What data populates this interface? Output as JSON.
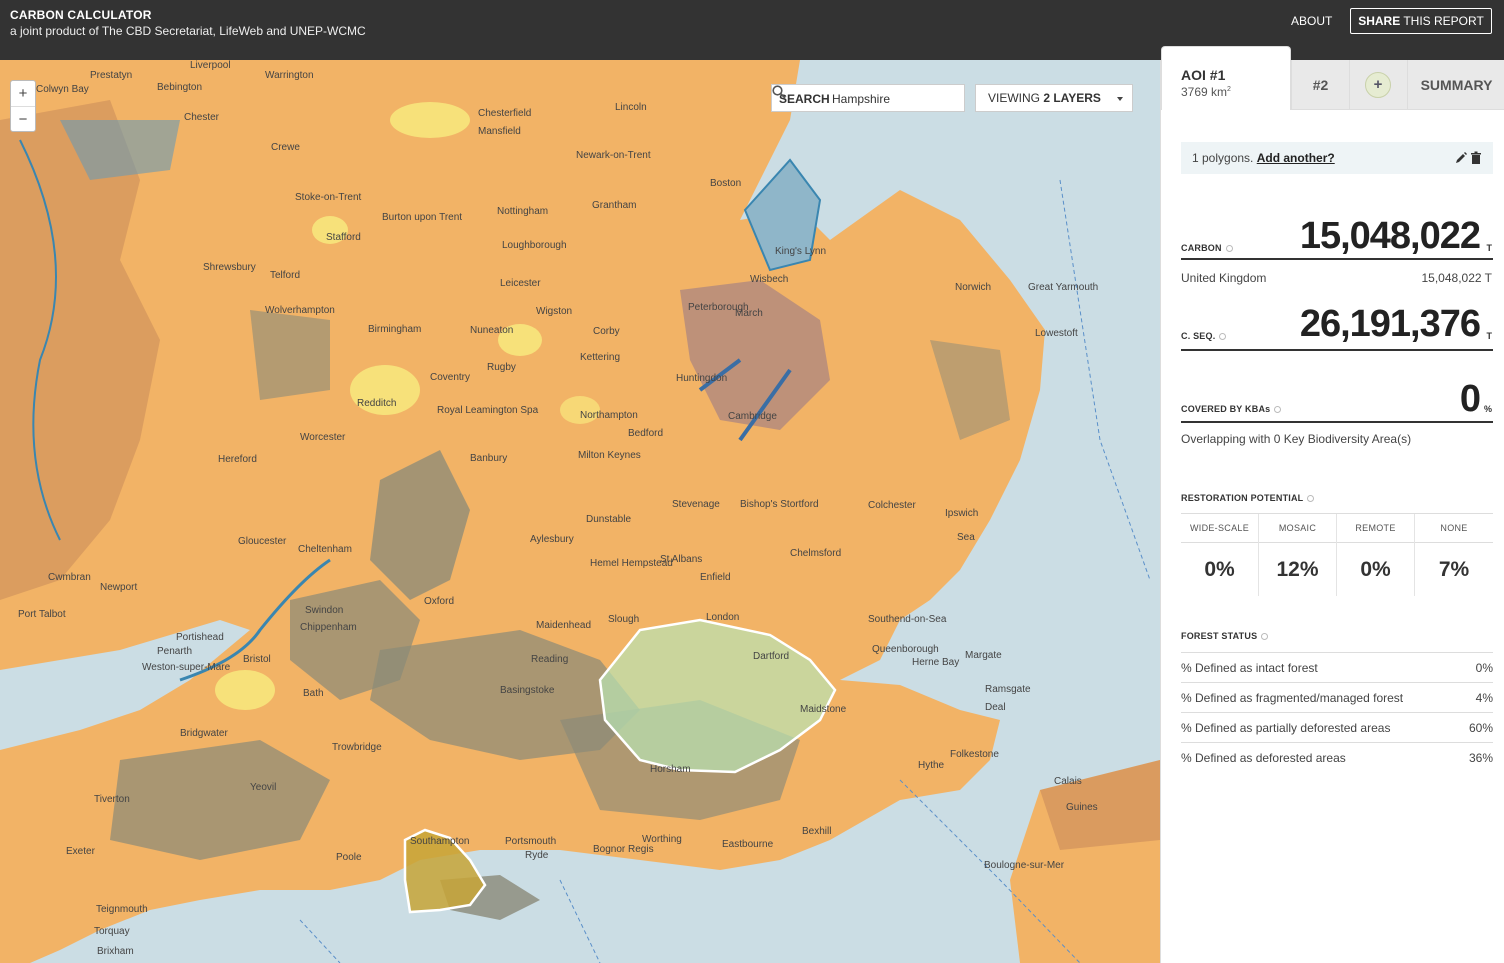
{
  "header": {
    "title": "CARBON CALCULATOR",
    "subtitle": "a joint product of The CBD Secretariat, LifeWeb and UNEP-WCMC",
    "about_label": "ABOUT",
    "share_bold": "SHARE",
    "share_rest": " THIS REPORT"
  },
  "map": {
    "zoom_in": "+",
    "zoom_out": "−",
    "search_label": "SEARCH",
    "search_value": "Hampshire",
    "layers_prefix": "VIEWING ",
    "layers_count": "2 LAYERS",
    "places": [
      "Prestatyn",
      "Colwyn Bay",
      "Liverpool",
      "Warrington",
      "Bebington",
      "Chester",
      "Crewe",
      "Stoke-on-Trent",
      "Stafford",
      "Shrewsbury",
      "Telford",
      "Wolverhampton",
      "Birmingham",
      "Nuneaton",
      "Leicester",
      "Nottingham",
      "Lincoln",
      "Boston",
      "Grantham",
      "Chesterfield",
      "Mansfield",
      "Newark-on-Trent",
      "Loughborough",
      "Burton upon Trent",
      "Wigston",
      "Corby",
      "Kettering",
      "Rugby",
      "Coventry",
      "Redditch",
      "Royal Leamington Spa",
      "Northampton",
      "Huntingdon",
      "Cambridge",
      "Bedford",
      "Milton Keynes",
      "Hereford",
      "Worcester",
      "Banbury",
      "Stevenage",
      "Bishop's Stortford",
      "Colchester",
      "Chelmsford",
      "Ipswich",
      "Lowestoft",
      "Great Yarmouth",
      "Norwich",
      "King's Lynn",
      "Wisbech",
      "March",
      "Peterborough",
      "Dunstable",
      "Aylesbury",
      "Hemel Hempstead",
      "St Albans",
      "Enfield",
      "London",
      "Slough",
      "Reading",
      "Maidenhead",
      "Basingstoke",
      "Southend-on-Sea",
      "Queenborough",
      "Herne Bay",
      "Margate",
      "Ramsgate",
      "Deal",
      "Folkestone",
      "Hythe",
      "Maidstone",
      "Dartford",
      "Swindon",
      "Chippenham",
      "Bristol",
      "Bath",
      "Portishead",
      "Penarth",
      "Weston-super-Mare",
      "Port Talbot",
      "Cwmbran",
      "Newport",
      "Trowbridge",
      "Bridgwater",
      "Yeovil",
      "Tiverton",
      "Exeter",
      "Teignmouth",
      "Torquay",
      "Brixham",
      "Poole",
      "Southampton",
      "Portsmouth",
      "Ryde",
      "Bognor Regis",
      "Worthing",
      "Eastbourne",
      "Bexhill",
      "Horsham",
      "Calais",
      "Boulogne-sur-Mer",
      "Guines",
      "Gloucester",
      "Cheltenham",
      "Oxford",
      "Sea"
    ]
  },
  "sidebar": {
    "tabs": {
      "aoi1_title": "AOI #1",
      "aoi1_area": "3769 km",
      "aoi1_area_sup": "2",
      "aoi2": "#2",
      "add": "+",
      "summary": "SUMMARY"
    },
    "polygons_text": "1 polygons. ",
    "polygons_link": "Add another?",
    "carbon": {
      "label": "CARBON",
      "value": "15,048,022",
      "unit": "T",
      "country": "United Kingdom",
      "country_value": "15,048,022 T"
    },
    "cseq": {
      "label": "C. SEQ.",
      "value": "26,191,376",
      "unit": "T"
    },
    "kba": {
      "label": "COVERED BY KBAs",
      "value": "0",
      "unit": "%",
      "note": "Overlapping with 0 Key Biodiversity Area(s)"
    },
    "restoration": {
      "title": "RESTORATION POTENTIAL",
      "columns": [
        {
          "head": "WIDE-SCALE",
          "value": "0%"
        },
        {
          "head": "MOSAIC",
          "value": "12%"
        },
        {
          "head": "REMOTE",
          "value": "0%"
        },
        {
          "head": "NONE",
          "value": "7%"
        }
      ]
    },
    "forest": {
      "title": "FOREST STATUS",
      "rows": [
        {
          "label": "% Defined as intact forest",
          "value": "0%"
        },
        {
          "label": "% Defined as fragmented/managed forest",
          "value": "4%"
        },
        {
          "label": "% Defined as partially deforested areas",
          "value": "60%"
        },
        {
          "label": "% Defined as deforested areas",
          "value": "36%"
        }
      ]
    }
  },
  "colors": {
    "header_bg": "#333333",
    "land_orange": "#f2b366",
    "land_yellow": "#f7e17a",
    "water": "#cbdde4",
    "protected": "#8a8a78",
    "aoi_green": "#b9e4b4",
    "aoi_yellow": "#c7a537"
  }
}
